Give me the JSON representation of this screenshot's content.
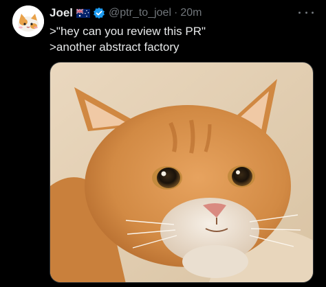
{
  "tweet": {
    "author": {
      "display_name": "Joel",
      "flag_icon": "australia-flag-icon",
      "verified_icon": "verified-badge-icon",
      "handle": "@ptr_to_joel",
      "separator": "·",
      "timestamp": "20m"
    },
    "text_lines": [
      ">\"hey can you review this PR\"",
      ">another abstract factory"
    ],
    "media": {
      "type": "photo",
      "subject": "orange cat"
    },
    "more_icon": "more-options-icon"
  },
  "colors": {
    "background": "#000000",
    "text_primary": "#e7e9ea",
    "text_secondary": "#71767b",
    "verified_blue": "#1d9bf0"
  }
}
